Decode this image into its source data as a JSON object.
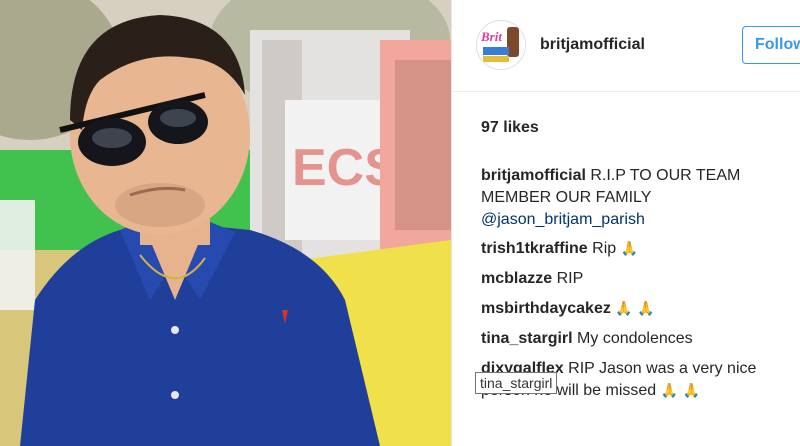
{
  "post": {
    "username": "britjamofficial",
    "follow_label": "Follow",
    "likes": "97 likes"
  },
  "comments": [
    {
      "user": "britjamofficial",
      "text": "R.I.P TO OUR TEAM MEMBER OUR FAMILY",
      "mention": "@jason_britjam_parish"
    },
    {
      "user": "trish1tkraffine",
      "text": "Rip",
      "emoji": "🙏"
    },
    {
      "user": "mcblazze",
      "text": "RIP"
    },
    {
      "user": "msbirthdaycakez",
      "text": "",
      "emoji": "🙏 🙏"
    },
    {
      "user": "tina_stargirl",
      "text": "My condolences"
    },
    {
      "user": "dixygalflex",
      "text": "RIP Jason was a very nice person he will be missed",
      "emoji": "🙏 🙏"
    }
  ],
  "tooltip": "tina_stargirl",
  "colors": {
    "shirt": "#1f3f9a",
    "accent_link": "#003569",
    "follow_blue": "#3897f0"
  },
  "icons": {
    "avatar": "britjam-logo-avatar",
    "prayer": "folded-hands-emoji"
  }
}
